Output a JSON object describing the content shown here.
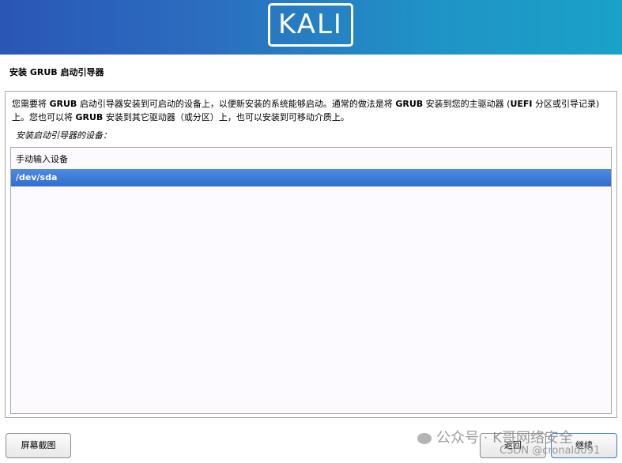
{
  "banner": {
    "logo_text": "KALI"
  },
  "page_title": "安装 GRUB 启动引导器",
  "description": {
    "p1": "您需要将 ",
    "b1": "GRUB",
    "p2": " 启动引导器安装到可启动的设备上，以便新安装的系统能够启动。通常的做法是将 ",
    "b2": "GRUB",
    "p3": " 安装到您的主驱动器 (",
    "b3": "UEFI",
    "p4": " 分区或引导记录) 上。您也可以将 ",
    "b4": "GRUB",
    "p5": " 安装到其它驱动器（或分区）上，也可以安装到可移动介质上。"
  },
  "prompt": "安装启动引导器的设备：",
  "devices": [
    {
      "label": "手动输入设备",
      "selected": false
    },
    {
      "label": "/dev/sda",
      "selected": true
    }
  ],
  "buttons": {
    "screenshot": "屏幕截图",
    "back": "返回",
    "continue": "继续"
  },
  "watermark": {
    "text": "公众号 · K哥网络安全",
    "csdn": "CSDN @cronald091"
  },
  "colors": {
    "banner_start": "#2a56b6",
    "banner_end": "#1aa2c8",
    "selection": "#2f6dcf"
  }
}
